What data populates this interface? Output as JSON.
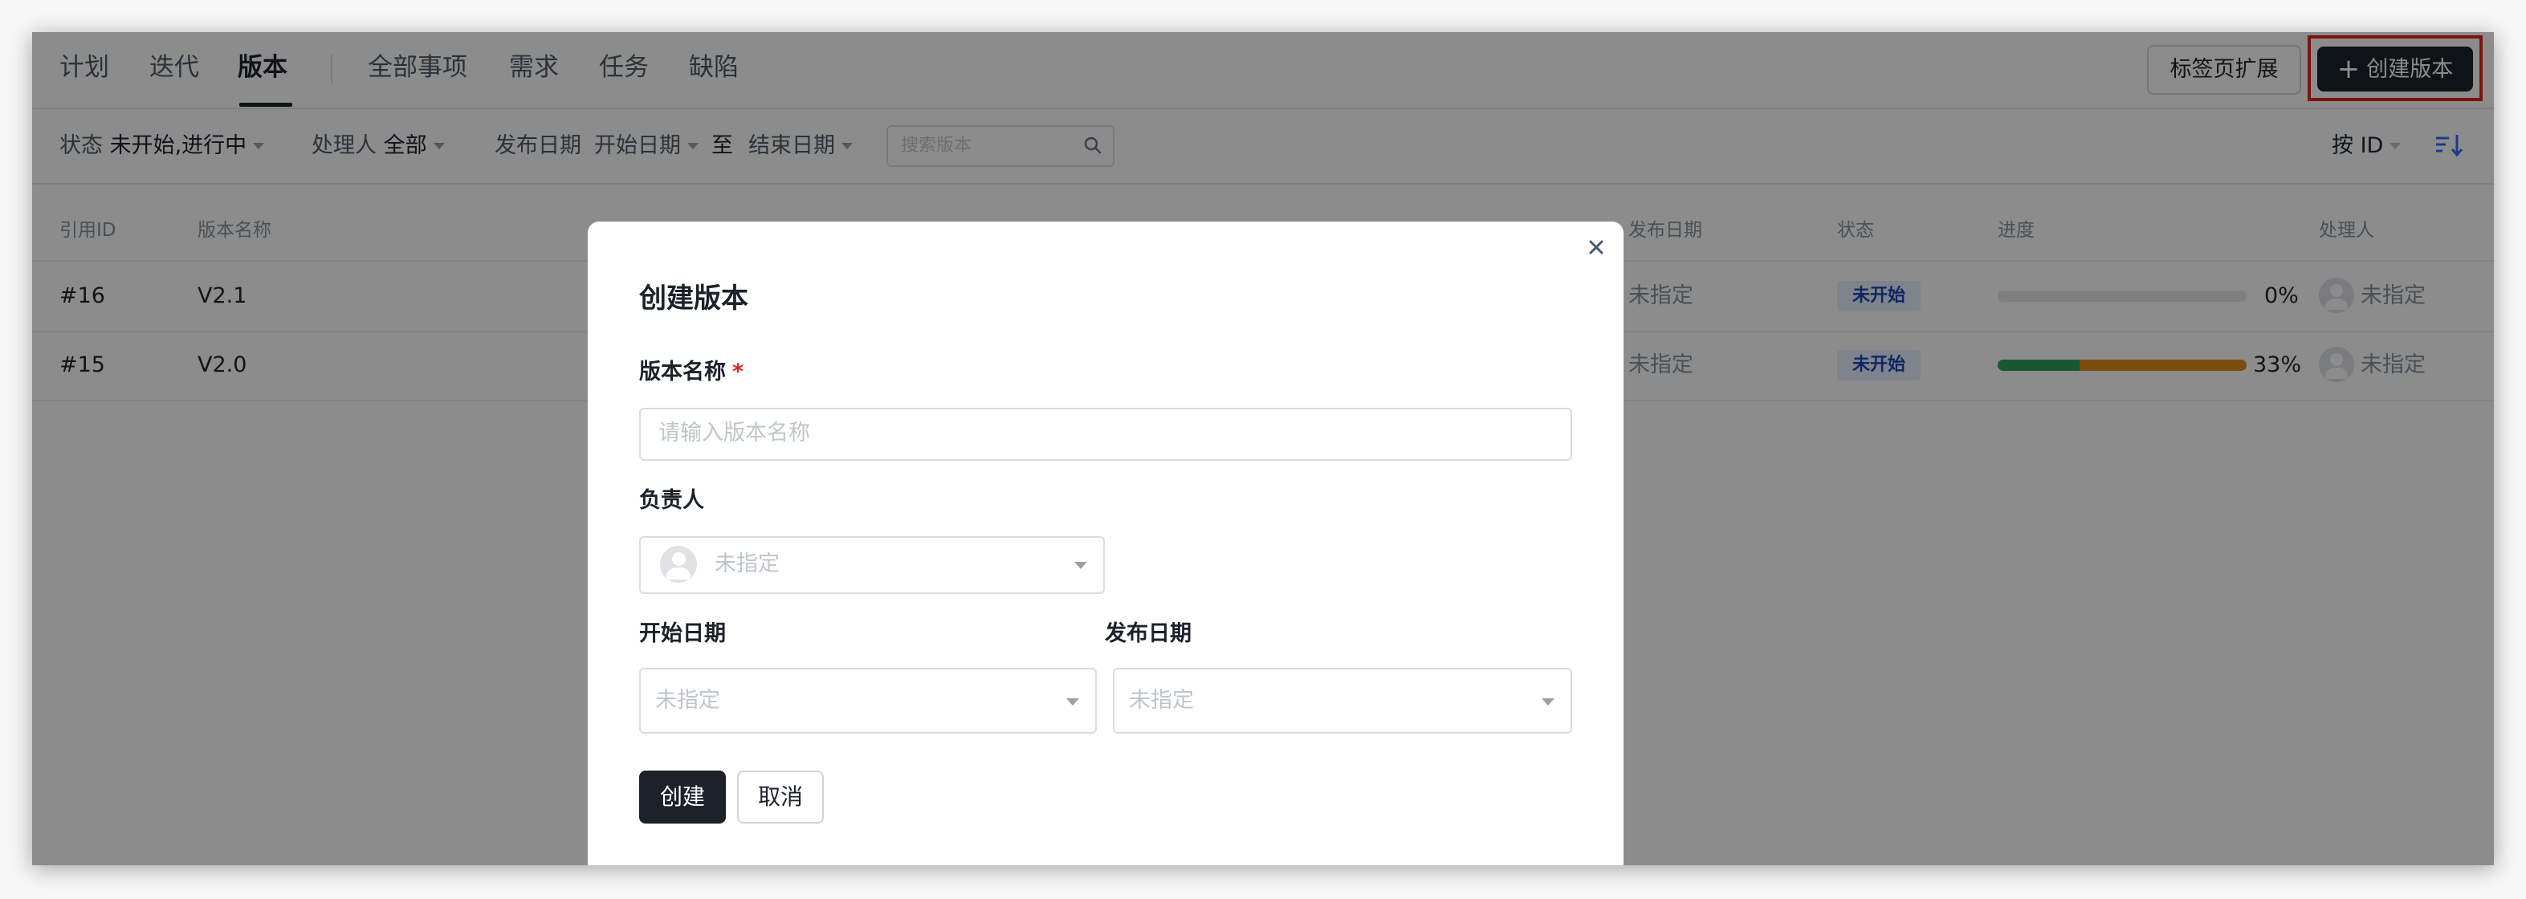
{
  "nav": {
    "tabs": [
      {
        "label": "计划"
      },
      {
        "label": "迭代"
      },
      {
        "label": "版本"
      },
      {
        "label": "全部事项"
      },
      {
        "label": "需求"
      },
      {
        "label": "任务"
      },
      {
        "label": "缺陷"
      }
    ],
    "active_tab": "版本",
    "tab_ext_label": "标签页扩展",
    "create_label": "创建版本"
  },
  "filters": {
    "status_label": "状态",
    "status_value": "未开始,进行中",
    "assignee_label": "处理人",
    "assignee_value": "全部",
    "date_label": "发布日期",
    "start_date": "开始日期",
    "to": "至",
    "end_date": "结束日期",
    "search_placeholder": "搜索版本",
    "sort_label": "按 ID"
  },
  "table": {
    "headers": {
      "id": "引用ID",
      "name": "版本名称",
      "release_date": "发布日期",
      "status": "状态",
      "progress": "进度",
      "assignee": "处理人"
    },
    "rows": [
      {
        "id": "#16",
        "name": "V2.1",
        "release_date": "未指定",
        "status": "未开始",
        "progress_text": "0%",
        "assignee": "未指定",
        "progress": {
          "done": 0,
          "in_progress": 0
        }
      },
      {
        "id": "#15",
        "name": "V2.0",
        "release_date": "未指定",
        "status": "未开始",
        "progress_text": "33%",
        "assignee": "未指定",
        "progress": {
          "done": 0.33,
          "in_progress": 0.67
        }
      }
    ]
  },
  "modal": {
    "title": "创建版本",
    "name_label": "版本名称",
    "required_mark": "*",
    "name_placeholder": "请输入版本名称",
    "owner_label": "负责人",
    "owner_value": "未指定",
    "start_label": "开始日期",
    "start_value": "未指定",
    "release_label": "发布日期",
    "release_value": "未指定",
    "create_button": "创建",
    "cancel_button": "取消"
  },
  "colors": {
    "primary_dark": "#1d2129",
    "highlight_red": "#e3231b",
    "badge_bg": "#e7eeff",
    "badge_text": "#1b45b4",
    "progress_done": "#2e9e5b",
    "progress_in_progress": "#e08a1e",
    "sort_blue": "#2f6bff"
  }
}
